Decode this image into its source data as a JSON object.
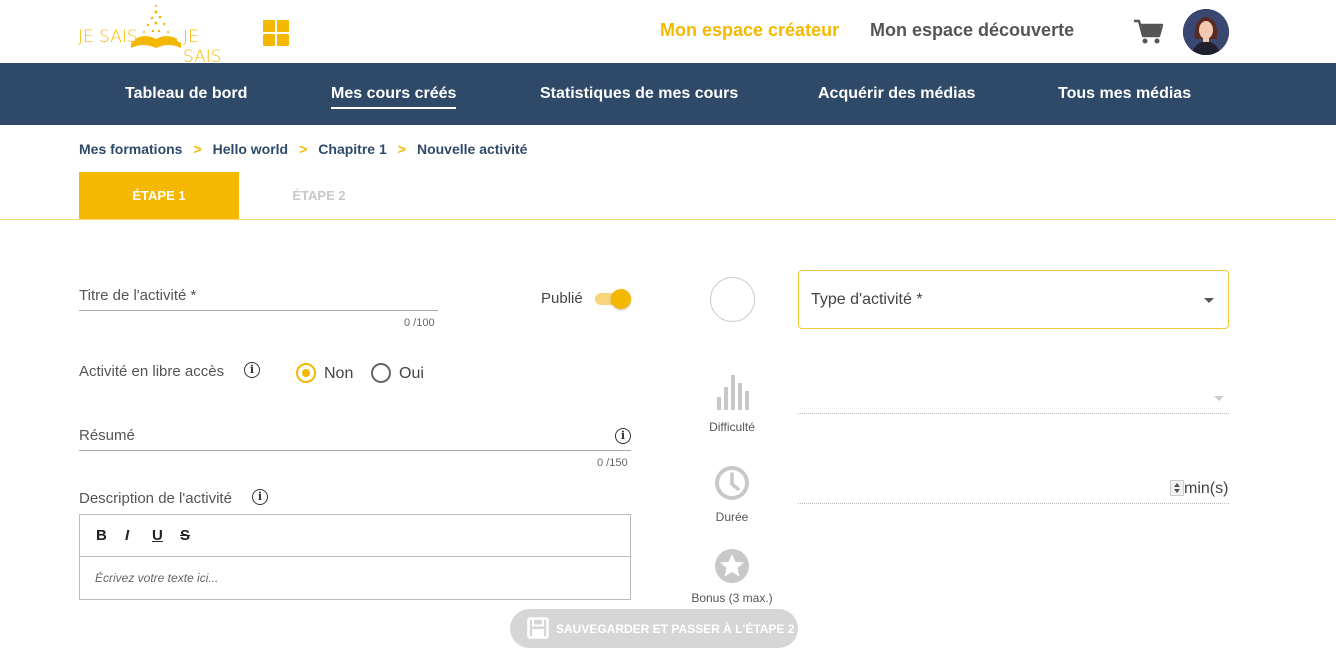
{
  "header": {
    "logo_left": "JE SAIS",
    "logo_right": "JE SAIS",
    "creator_space": "Mon espace créateur",
    "discovery_space": "Mon espace découverte"
  },
  "nav": {
    "items": [
      {
        "label": "Tableau de bord"
      },
      {
        "label": "Mes cours créés"
      },
      {
        "label": "Statistiques de mes cours"
      },
      {
        "label": "Acquérir des médias"
      },
      {
        "label": "Tous mes médias"
      }
    ]
  },
  "breadcrumb": {
    "items": [
      "Mes formations",
      "Hello world",
      "Chapitre 1",
      "Nouvelle activité"
    ],
    "separator": ">"
  },
  "steps": {
    "step1": "ÉTAPE 1",
    "step2": "ÉTAPE 2"
  },
  "form": {
    "title_label": "Titre de l'activité *",
    "title_counter": "0 /100",
    "published_label": "Publié",
    "published_on": true,
    "free_access_label": "Activité en libre accès",
    "free_access_options": [
      "Non",
      "Oui"
    ],
    "free_access_selected": "Non",
    "summary_label": "Résumé",
    "summary_counter": "0 /150",
    "description_label": "Description de l'activité",
    "editor_tools": [
      "B",
      "I",
      "U",
      "S"
    ],
    "editor_placeholder": "Écrivez votre texte ici..."
  },
  "middle": {
    "difficulty_label": "Difficulté",
    "duration_label": "Durée",
    "bonus_label": "Bonus (3 max.)"
  },
  "right": {
    "type_label": "Type d'activité *",
    "duration_unit": "min(s)"
  },
  "save_button": "SAUVEGARDER ET PASSER À L'ÉTAPE 2",
  "colors": {
    "accent": "#f5b800",
    "navbar": "#2f4a68"
  }
}
